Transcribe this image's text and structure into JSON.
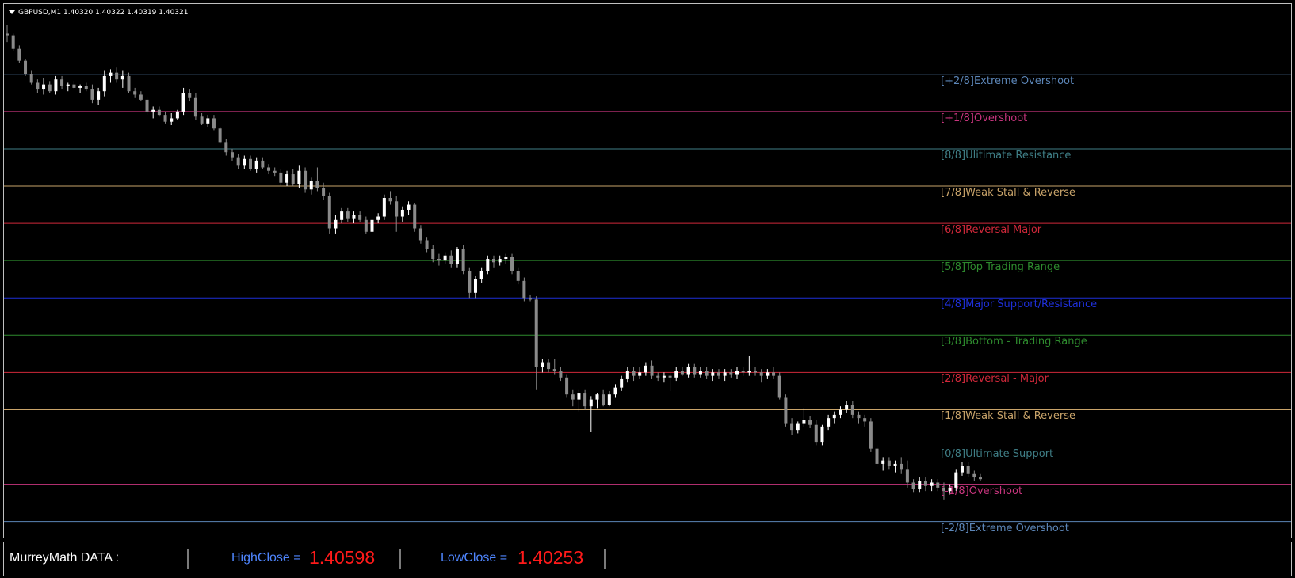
{
  "window": {
    "title": "GBPUSD,M1  1.40320 1.40322 1.40319 1.40321"
  },
  "colors": {
    "background": "#000000",
    "bull_candle": "#ffffff",
    "bear_candle": "#8a8a8a",
    "panel_label": "#4f86ff",
    "panel_value": "#ff1a1a"
  },
  "levels": [
    {
      "label": "[+2/8]Extreme Overshoot",
      "color": "#5c86b8",
      "price": 1.40642
    },
    {
      "label": "[+1/8]Overshoot",
      "color": "#c8357e",
      "price": 1.40598
    },
    {
      "label": "[8/8]Ulitimate Resistance",
      "color": "#3f7e86",
      "price": 1.40554
    },
    {
      "label": "[7/8]Weak Stall & Reverse",
      "color": "#c9a46a",
      "price": 1.4051
    },
    {
      "label": "[6/8]Reversal Major",
      "color": "#d0283a",
      "price": 1.40466
    },
    {
      "label": "[5/8]Top Trading Range",
      "color": "#2e8b2e",
      "price": 1.40422
    },
    {
      "label": "[4/8]Major Support/Resistance",
      "color": "#1e2fd8",
      "price": 1.40378
    },
    {
      "label": "[3/8]Bottom - Trading Range",
      "color": "#2e8b2e",
      "price": 1.40334
    },
    {
      "label": "[2/8]Reversal - Major",
      "color": "#d0283a",
      "price": 1.4029
    },
    {
      "label": "[1/8]Weak Stall & Reverse",
      "color": "#c9a46a",
      "price": 1.40246
    },
    {
      "label": "[0/8]Ultimate Support",
      "color": "#3f7e86",
      "price": 1.40202
    },
    {
      "label": "[-1/8]Overshoot",
      "color": "#c8357e",
      "price": 1.40158
    },
    {
      "label": "[-2/8]Extreme Overshoot",
      "color": "#5c86b8",
      "price": 1.40114
    }
  ],
  "panel": {
    "title": "MurreyMath DATA :",
    "high_label": "HighClose  =",
    "high_value": "1.40598",
    "low_label": "LowClose  =",
    "low_value": "1.40253"
  },
  "chart_data": {
    "type": "candlestick",
    "symbol": "GBPUSD",
    "timeframe": "M1",
    "ylim": [
      1.40095,
      1.40725
    ],
    "grid": false,
    "series": [
      {
        "o": 1.4069,
        "h": 1.407,
        "l": 1.4068,
        "c": 1.40688
      },
      {
        "o": 1.40688,
        "h": 1.4069,
        "l": 1.4067,
        "c": 1.40672
      },
      {
        "o": 1.40672,
        "h": 1.40676,
        "l": 1.40655,
        "c": 1.40658
      },
      {
        "o": 1.40658,
        "h": 1.4066,
        "l": 1.4064,
        "c": 1.40642
      },
      {
        "o": 1.40642,
        "h": 1.40646,
        "l": 1.4063,
        "c": 1.40632
      },
      {
        "o": 1.40632,
        "h": 1.40636,
        "l": 1.4062,
        "c": 1.40624
      },
      {
        "o": 1.40624,
        "h": 1.40638,
        "l": 1.40618,
        "c": 1.4063
      },
      {
        "o": 1.4063,
        "h": 1.40634,
        "l": 1.4062,
        "c": 1.40622
      },
      {
        "o": 1.40622,
        "h": 1.4064,
        "l": 1.40618,
        "c": 1.40636
      },
      {
        "o": 1.40636,
        "h": 1.4064,
        "l": 1.40624,
        "c": 1.40628
      },
      {
        "o": 1.40628,
        "h": 1.40632,
        "l": 1.40622,
        "c": 1.4063
      },
      {
        "o": 1.4063,
        "h": 1.40634,
        "l": 1.40624,
        "c": 1.40626
      },
      {
        "o": 1.40626,
        "h": 1.4063,
        "l": 1.4062,
        "c": 1.40628
      },
      {
        "o": 1.40628,
        "h": 1.40632,
        "l": 1.40622,
        "c": 1.40624
      },
      {
        "o": 1.40624,
        "h": 1.4063,
        "l": 1.40608,
        "c": 1.40612
      },
      {
        "o": 1.40612,
        "h": 1.40626,
        "l": 1.40606,
        "c": 1.40622
      },
      {
        "o": 1.40622,
        "h": 1.40646,
        "l": 1.40616,
        "c": 1.4064
      },
      {
        "o": 1.4064,
        "h": 1.40648,
        "l": 1.40632,
        "c": 1.40644
      },
      {
        "o": 1.40644,
        "h": 1.4065,
        "l": 1.40632,
        "c": 1.40636
      },
      {
        "o": 1.40636,
        "h": 1.40646,
        "l": 1.40626,
        "c": 1.4064
      },
      {
        "o": 1.4064,
        "h": 1.40644,
        "l": 1.4062,
        "c": 1.40622
      },
      {
        "o": 1.40622,
        "h": 1.40626,
        "l": 1.40614,
        "c": 1.40618
      },
      {
        "o": 1.40618,
        "h": 1.40622,
        "l": 1.4061,
        "c": 1.40612
      },
      {
        "o": 1.40612,
        "h": 1.40616,
        "l": 1.40594,
        "c": 1.40598
      },
      {
        "o": 1.40598,
        "h": 1.40604,
        "l": 1.4059,
        "c": 1.406
      },
      {
        "o": 1.406,
        "h": 1.40604,
        "l": 1.40592,
        "c": 1.40594
      },
      {
        "o": 1.40594,
        "h": 1.40598,
        "l": 1.40584,
        "c": 1.40586
      },
      {
        "o": 1.40586,
        "h": 1.40596,
        "l": 1.40582,
        "c": 1.4059
      },
      {
        "o": 1.4059,
        "h": 1.406,
        "l": 1.40588,
        "c": 1.40598
      },
      {
        "o": 1.40598,
        "h": 1.40626,
        "l": 1.40594,
        "c": 1.4062
      },
      {
        "o": 1.4062,
        "h": 1.40624,
        "l": 1.4061,
        "c": 1.40614
      },
      {
        "o": 1.40614,
        "h": 1.4062,
        "l": 1.40588,
        "c": 1.40592
      },
      {
        "o": 1.40592,
        "h": 1.40596,
        "l": 1.40582,
        "c": 1.40584
      },
      {
        "o": 1.40584,
        "h": 1.40594,
        "l": 1.4058,
        "c": 1.4059
      },
      {
        "o": 1.4059,
        "h": 1.40594,
        "l": 1.40576,
        "c": 1.40578
      },
      {
        "o": 1.40578,
        "h": 1.4058,
        "l": 1.4056,
        "c": 1.40562
      },
      {
        "o": 1.40562,
        "h": 1.40566,
        "l": 1.40546,
        "c": 1.4055
      },
      {
        "o": 1.4055,
        "h": 1.40554,
        "l": 1.4054,
        "c": 1.40544
      },
      {
        "o": 1.40544,
        "h": 1.40548,
        "l": 1.4053,
        "c": 1.40534
      },
      {
        "o": 1.40534,
        "h": 1.40546,
        "l": 1.4053,
        "c": 1.40542
      },
      {
        "o": 1.40542,
        "h": 1.40546,
        "l": 1.40528,
        "c": 1.4053
      },
      {
        "o": 1.4053,
        "h": 1.40544,
        "l": 1.40526,
        "c": 1.4054
      },
      {
        "o": 1.4054,
        "h": 1.40544,
        "l": 1.4053,
        "c": 1.40532
      },
      {
        "o": 1.40532,
        "h": 1.40536,
        "l": 1.40524,
        "c": 1.40528
      },
      {
        "o": 1.40528,
        "h": 1.40532,
        "l": 1.40522,
        "c": 1.40526
      },
      {
        "o": 1.40526,
        "h": 1.4053,
        "l": 1.4051,
        "c": 1.40514
      },
      {
        "o": 1.40514,
        "h": 1.40528,
        "l": 1.4051,
        "c": 1.40524
      },
      {
        "o": 1.40524,
        "h": 1.4053,
        "l": 1.4051,
        "c": 1.40512
      },
      {
        "o": 1.40512,
        "h": 1.40534,
        "l": 1.40508,
        "c": 1.40528
      },
      {
        "o": 1.40528,
        "h": 1.40532,
        "l": 1.40502,
        "c": 1.40506
      },
      {
        "o": 1.40506,
        "h": 1.4052,
        "l": 1.405,
        "c": 1.40516
      },
      {
        "o": 1.40516,
        "h": 1.40532,
        "l": 1.40504,
        "c": 1.40508
      },
      {
        "o": 1.40508,
        "h": 1.40514,
        "l": 1.40494,
        "c": 1.40498
      },
      {
        "o": 1.40498,
        "h": 1.40502,
        "l": 1.40454,
        "c": 1.4046
      },
      {
        "o": 1.4046,
        "h": 1.40476,
        "l": 1.40454,
        "c": 1.4047
      },
      {
        "o": 1.4047,
        "h": 1.40484,
        "l": 1.40466,
        "c": 1.4048
      },
      {
        "o": 1.4048,
        "h": 1.40484,
        "l": 1.40468,
        "c": 1.40472
      },
      {
        "o": 1.40472,
        "h": 1.4048,
        "l": 1.40466,
        "c": 1.40476
      },
      {
        "o": 1.40476,
        "h": 1.4048,
        "l": 1.40468,
        "c": 1.4047
      },
      {
        "o": 1.4047,
        "h": 1.40474,
        "l": 1.40454,
        "c": 1.40456
      },
      {
        "o": 1.40456,
        "h": 1.40474,
        "l": 1.40454,
        "c": 1.4047
      },
      {
        "o": 1.4047,
        "h": 1.40478,
        "l": 1.40466,
        "c": 1.40474
      },
      {
        "o": 1.40474,
        "h": 1.405,
        "l": 1.4047,
        "c": 1.40496
      },
      {
        "o": 1.40496,
        "h": 1.40504,
        "l": 1.40488,
        "c": 1.40492
      },
      {
        "o": 1.40492,
        "h": 1.40498,
        "l": 1.40456,
        "c": 1.40474
      },
      {
        "o": 1.40474,
        "h": 1.40486,
        "l": 1.40468,
        "c": 1.40482
      },
      {
        "o": 1.40482,
        "h": 1.40492,
        "l": 1.40476,
        "c": 1.40488
      },
      {
        "o": 1.40488,
        "h": 1.4049,
        "l": 1.40456,
        "c": 1.4046
      },
      {
        "o": 1.4046,
        "h": 1.40464,
        "l": 1.40442,
        "c": 1.40446
      },
      {
        "o": 1.40446,
        "h": 1.4045,
        "l": 1.40432,
        "c": 1.40436
      },
      {
        "o": 1.40436,
        "h": 1.4044,
        "l": 1.4042,
        "c": 1.40424
      },
      {
        "o": 1.40424,
        "h": 1.4043,
        "l": 1.40416,
        "c": 1.40422
      },
      {
        "o": 1.40422,
        "h": 1.40432,
        "l": 1.40418,
        "c": 1.40428
      },
      {
        "o": 1.40428,
        "h": 1.40434,
        "l": 1.40414,
        "c": 1.40418
      },
      {
        "o": 1.40418,
        "h": 1.40438,
        "l": 1.40414,
        "c": 1.40436
      },
      {
        "o": 1.40436,
        "h": 1.4044,
        "l": 1.40406,
        "c": 1.4041
      },
      {
        "o": 1.4041,
        "h": 1.40414,
        "l": 1.40378,
        "c": 1.40384
      },
      {
        "o": 1.40384,
        "h": 1.40404,
        "l": 1.40378,
        "c": 1.404
      },
      {
        "o": 1.404,
        "h": 1.40414,
        "l": 1.40396,
        "c": 1.4041
      },
      {
        "o": 1.4041,
        "h": 1.40428,
        "l": 1.40406,
        "c": 1.40424
      },
      {
        "o": 1.40424,
        "h": 1.40428,
        "l": 1.40414,
        "c": 1.4042
      },
      {
        "o": 1.4042,
        "h": 1.40428,
        "l": 1.40416,
        "c": 1.40424
      },
      {
        "o": 1.40424,
        "h": 1.4043,
        "l": 1.40418,
        "c": 1.40426
      },
      {
        "o": 1.40426,
        "h": 1.4043,
        "l": 1.40406,
        "c": 1.4041
      },
      {
        "o": 1.4041,
        "h": 1.40414,
        "l": 1.40394,
        "c": 1.40398
      },
      {
        "o": 1.40398,
        "h": 1.40402,
        "l": 1.40374,
        "c": 1.40378
      },
      {
        "o": 1.40378,
        "h": 1.40382,
        "l": 1.40374,
        "c": 1.40376
      },
      {
        "o": 1.40376,
        "h": 1.4038,
        "l": 1.4027,
        "c": 1.40296
      },
      {
        "o": 1.40296,
        "h": 1.40306,
        "l": 1.4029,
        "c": 1.40302
      },
      {
        "o": 1.40302,
        "h": 1.40306,
        "l": 1.4029,
        "c": 1.40294
      },
      {
        "o": 1.40294,
        "h": 1.40306,
        "l": 1.40288,
        "c": 1.40292
      },
      {
        "o": 1.40292,
        "h": 1.40296,
        "l": 1.4028,
        "c": 1.40284
      },
      {
        "o": 1.40284,
        "h": 1.40288,
        "l": 1.4026,
        "c": 1.40264
      },
      {
        "o": 1.40264,
        "h": 1.4027,
        "l": 1.4025,
        "c": 1.40258
      },
      {
        "o": 1.40258,
        "h": 1.4027,
        "l": 1.40244,
        "c": 1.40266
      },
      {
        "o": 1.40266,
        "h": 1.4027,
        "l": 1.40246,
        "c": 1.4025
      },
      {
        "o": 1.4025,
        "h": 1.40262,
        "l": 1.4022,
        "c": 1.40258
      },
      {
        "o": 1.40258,
        "h": 1.40266,
        "l": 1.40248,
        "c": 1.40264
      },
      {
        "o": 1.40264,
        "h": 1.4027,
        "l": 1.4025,
        "c": 1.40252
      },
      {
        "o": 1.40252,
        "h": 1.40268,
        "l": 1.4025,
        "c": 1.40264
      },
      {
        "o": 1.40264,
        "h": 1.40276,
        "l": 1.4026,
        "c": 1.40272
      },
      {
        "o": 1.40272,
        "h": 1.40286,
        "l": 1.40268,
        "c": 1.40282
      },
      {
        "o": 1.40282,
        "h": 1.40296,
        "l": 1.40278,
        "c": 1.40292
      },
      {
        "o": 1.40292,
        "h": 1.40296,
        "l": 1.4028,
        "c": 1.40286
      },
      {
        "o": 1.40286,
        "h": 1.40296,
        "l": 1.40282,
        "c": 1.4029
      },
      {
        "o": 1.4029,
        "h": 1.40302,
        "l": 1.40286,
        "c": 1.40298
      },
      {
        "o": 1.40298,
        "h": 1.40304,
        "l": 1.40282,
        "c": 1.40286
      },
      {
        "o": 1.40286,
        "h": 1.4029,
        "l": 1.4028,
        "c": 1.40284
      },
      {
        "o": 1.40284,
        "h": 1.4029,
        "l": 1.40278,
        "c": 1.40286
      },
      {
        "o": 1.40286,
        "h": 1.4029,
        "l": 1.40268,
        "c": 1.40284
      },
      {
        "o": 1.40284,
        "h": 1.40296,
        "l": 1.4028,
        "c": 1.40292
      },
      {
        "o": 1.40292,
        "h": 1.40296,
        "l": 1.40286,
        "c": 1.40288
      },
      {
        "o": 1.40288,
        "h": 1.403,
        "l": 1.40284,
        "c": 1.40296
      },
      {
        "o": 1.40296,
        "h": 1.403,
        "l": 1.40284,
        "c": 1.40288
      },
      {
        "o": 1.40288,
        "h": 1.40296,
        "l": 1.40284,
        "c": 1.40292
      },
      {
        "o": 1.40292,
        "h": 1.40296,
        "l": 1.40282,
        "c": 1.40286
      },
      {
        "o": 1.40286,
        "h": 1.40294,
        "l": 1.4028,
        "c": 1.4029
      },
      {
        "o": 1.4029,
        "h": 1.40294,
        "l": 1.40282,
        "c": 1.40286
      },
      {
        "o": 1.40286,
        "h": 1.40294,
        "l": 1.4028,
        "c": 1.4029
      },
      {
        "o": 1.4029,
        "h": 1.40294,
        "l": 1.40284,
        "c": 1.40288
      },
      {
        "o": 1.40288,
        "h": 1.40296,
        "l": 1.40282,
        "c": 1.40292
      },
      {
        "o": 1.40292,
        "h": 1.40296,
        "l": 1.40286,
        "c": 1.4029
      },
      {
        "o": 1.4029,
        "h": 1.4031,
        "l": 1.40286,
        "c": 1.40292
      },
      {
        "o": 1.40292,
        "h": 1.40296,
        "l": 1.40286,
        "c": 1.4029
      },
      {
        "o": 1.4029,
        "h": 1.40294,
        "l": 1.40278,
        "c": 1.40286
      },
      {
        "o": 1.40286,
        "h": 1.40294,
        "l": 1.40282,
        "c": 1.4029
      },
      {
        "o": 1.4029,
        "h": 1.40296,
        "l": 1.40282,
        "c": 1.40286
      },
      {
        "o": 1.40286,
        "h": 1.4029,
        "l": 1.40258,
        "c": 1.4026
      },
      {
        "o": 1.4026,
        "h": 1.40264,
        "l": 1.40226,
        "c": 1.4023
      },
      {
        "o": 1.4023,
        "h": 1.40236,
        "l": 1.40216,
        "c": 1.40222
      },
      {
        "o": 1.40222,
        "h": 1.40232,
        "l": 1.40218,
        "c": 1.4023
      },
      {
        "o": 1.4023,
        "h": 1.40248,
        "l": 1.40226,
        "c": 1.40234
      },
      {
        "o": 1.40234,
        "h": 1.40238,
        "l": 1.40224,
        "c": 1.40228
      },
      {
        "o": 1.40228,
        "h": 1.40234,
        "l": 1.40204,
        "c": 1.40208
      },
      {
        "o": 1.40208,
        "h": 1.40228,
        "l": 1.40204,
        "c": 1.40226
      },
      {
        "o": 1.40226,
        "h": 1.4024,
        "l": 1.40222,
        "c": 1.40236
      },
      {
        "o": 1.40236,
        "h": 1.40244,
        "l": 1.4023,
        "c": 1.4024
      },
      {
        "o": 1.4024,
        "h": 1.4025,
        "l": 1.40236,
        "c": 1.40246
      },
      {
        "o": 1.40246,
        "h": 1.40256,
        "l": 1.40242,
        "c": 1.40252
      },
      {
        "o": 1.40252,
        "h": 1.40256,
        "l": 1.40236,
        "c": 1.4024
      },
      {
        "o": 1.4024,
        "h": 1.40244,
        "l": 1.4023,
        "c": 1.40236
      },
      {
        "o": 1.40236,
        "h": 1.4024,
        "l": 1.40226,
        "c": 1.40232
      },
      {
        "o": 1.40232,
        "h": 1.40236,
        "l": 1.40196,
        "c": 1.402
      },
      {
        "o": 1.402,
        "h": 1.40204,
        "l": 1.40178,
        "c": 1.40182
      },
      {
        "o": 1.40182,
        "h": 1.4019,
        "l": 1.40174,
        "c": 1.40186
      },
      {
        "o": 1.40186,
        "h": 1.4019,
        "l": 1.40176,
        "c": 1.4018
      },
      {
        "o": 1.4018,
        "h": 1.40186,
        "l": 1.40172,
        "c": 1.40182
      },
      {
        "o": 1.40182,
        "h": 1.4019,
        "l": 1.4017,
        "c": 1.40176
      },
      {
        "o": 1.40176,
        "h": 1.40186,
        "l": 1.40154,
        "c": 1.4016
      },
      {
        "o": 1.4016,
        "h": 1.40164,
        "l": 1.40148,
        "c": 1.40152
      },
      {
        "o": 1.40152,
        "h": 1.40166,
        "l": 1.40148,
        "c": 1.40162
      },
      {
        "o": 1.40162,
        "h": 1.40166,
        "l": 1.4015,
        "c": 1.40156
      },
      {
        "o": 1.40156,
        "h": 1.40164,
        "l": 1.4015,
        "c": 1.4016
      },
      {
        "o": 1.4016,
        "h": 1.40164,
        "l": 1.4015,
        "c": 1.40154
      },
      {
        "o": 1.40154,
        "h": 1.4016,
        "l": 1.4014,
        "c": 1.4015
      },
      {
        "o": 1.4015,
        "h": 1.40158,
        "l": 1.40146,
        "c": 1.40154
      },
      {
        "o": 1.40154,
        "h": 1.40176,
        "l": 1.4015,
        "c": 1.40172
      },
      {
        "o": 1.40172,
        "h": 1.40184,
        "l": 1.40168,
        "c": 1.4018
      },
      {
        "o": 1.4018,
        "h": 1.40184,
        "l": 1.40166,
        "c": 1.4017
      },
      {
        "o": 1.4017,
        "h": 1.40174,
        "l": 1.40162,
        "c": 1.40166
      },
      {
        "o": 1.40166,
        "h": 1.4017,
        "l": 1.40162,
        "c": 1.40164
      }
    ]
  }
}
